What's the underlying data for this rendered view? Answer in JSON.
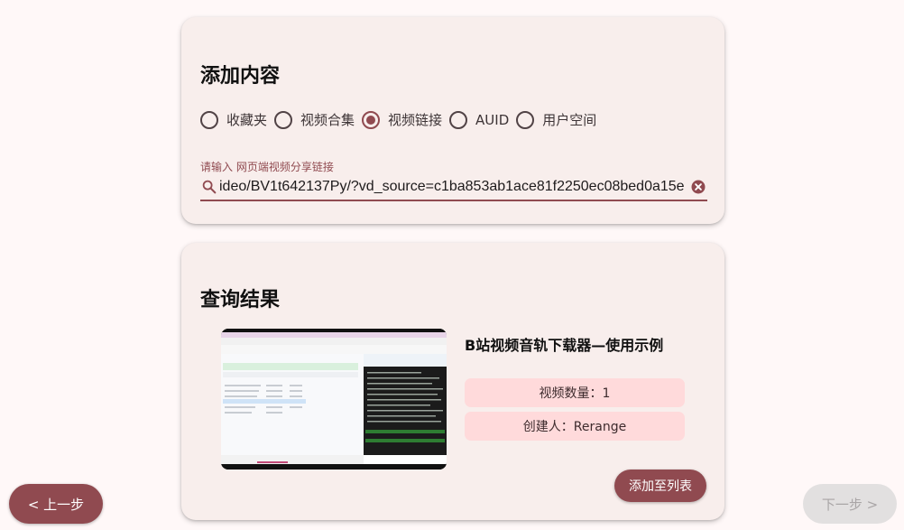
{
  "add_section": {
    "title": "添加内容",
    "options": [
      {
        "label": "收藏夹",
        "checked": false
      },
      {
        "label": "视频合集",
        "checked": false
      },
      {
        "label": "视频链接",
        "checked": true
      },
      {
        "label": "AUID",
        "checked": false
      },
      {
        "label": "用户空间",
        "checked": false
      }
    ],
    "url_field": {
      "label": "请输入 网页端视频分享链接",
      "value": "ideo/BV1t642137Py/?vd_source=c1ba853ab1ace81f2250ec08bed0a15e",
      "icon": "search-icon",
      "clear_icon": "clear-icon"
    }
  },
  "result_section": {
    "title": "查询结果",
    "video": {
      "title": "B站视频音轨下载器—使用示例",
      "count": "视频数量：1",
      "creator": "创建人：Rerange"
    },
    "add_button": "添加至列表"
  },
  "nav": {
    "prev": "< 上一步",
    "next": "下一步 >"
  },
  "colors": {
    "primary": "#904a50",
    "card_bg": "#f8eeec",
    "chip_bg": "#ffdadb",
    "page_bg": "#fff8f8"
  }
}
